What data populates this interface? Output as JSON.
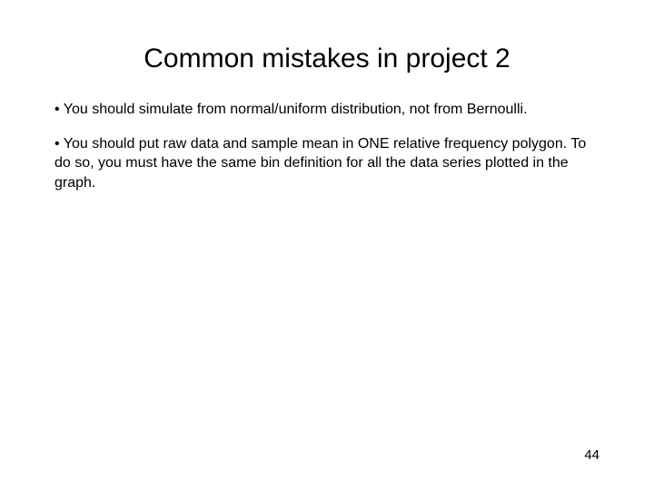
{
  "slide": {
    "title": "Common mistakes in project 2",
    "bullets": [
      "• You should simulate from normal/uniform distribution, not from Bernoulli.",
      "• You should put raw data and sample mean in ONE relative frequency polygon. To do so, you must have the same bin definition for all the data series plotted in the graph."
    ],
    "page_number": "44"
  }
}
